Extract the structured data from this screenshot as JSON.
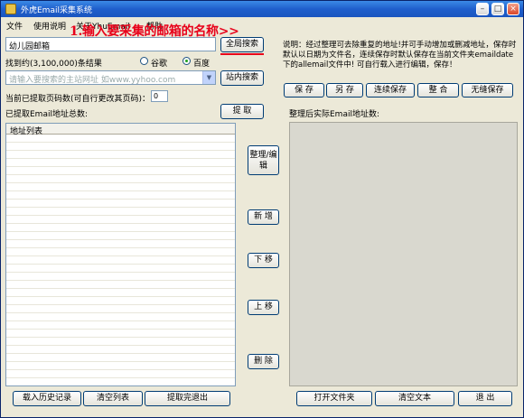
{
  "window": {
    "title": "外虎Email采集系统"
  },
  "menu": [
    "文件",
    "使用说明",
    "关于YhuEmail",
    "帮助"
  ],
  "annotation": {
    "text": "1.输入要采集的邮箱的名称>>"
  },
  "search": {
    "value": "幼儿园邮箱",
    "global_search_label": "全局搜索",
    "result_text": "找到约(3,100,000)条结果",
    "engines": [
      {
        "label": "谷歌",
        "selected": false
      },
      {
        "label": "百度",
        "selected": true
      }
    ]
  },
  "site": {
    "placeholder": "请输入要搜索的主站网址 如www.yyhoo.com",
    "button_label": "站内搜索"
  },
  "pages": {
    "label": "当前已提取页码数(可自行更改其页码)：",
    "value": "0"
  },
  "extracted": {
    "label": "已提取Email地址总数:",
    "button_label": "提 取"
  },
  "address_list": {
    "header": "地址列表"
  },
  "middle_buttons": [
    "整理/编辑",
    "新 增",
    "下 移",
    "上 移",
    "删 除"
  ],
  "description": "说明：经过整理可去除重复的地址!并可手动增加或删减地址，保存时默认以日期为文件名，连续保存时默认保存在当前文件夹emaildate下的allemail文件中! 可自行载入进行编辑，保存！",
  "right_buttons": [
    "保 存",
    "另 存",
    "连续保存",
    "整 合",
    "无缝保存"
  ],
  "actual_label": "整理后实际Email地址数:",
  "bottom_left_buttons": [
    "载入历史记录",
    "清空列表",
    "提取完退出"
  ],
  "bottom_right_buttons": [
    "打开文件夹",
    "清空文本",
    "退 出"
  ]
}
